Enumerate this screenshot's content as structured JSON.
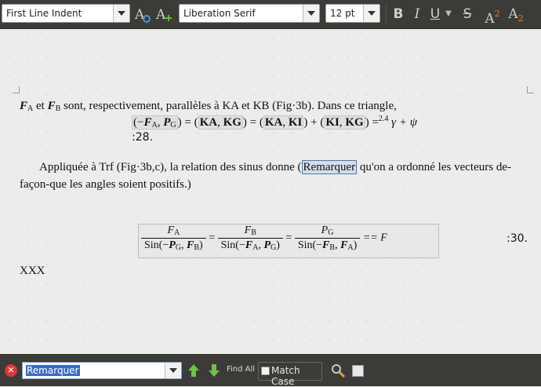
{
  "toolbar": {
    "paragraph_style": "First Line Indent",
    "font_name": "Liberation Serif",
    "font_size": "12 pt",
    "bold": "B",
    "italic": "I",
    "underline": "U",
    "strike": "S",
    "superscript": "A",
    "superscript_mark": "2",
    "subscript": "A",
    "subscript_mark": "2"
  },
  "document": {
    "line1": {
      "fa": "F",
      "fa_sub": "A",
      "et": " et ",
      "fb": "F",
      "fb_sub": "B",
      "rest": " sont, respectivement, parallèles à KA et KB (Fig·3b). Dans ce triangle,"
    },
    "eq1": {
      "open": "(−",
      "fa": "F",
      "fa_sub": "A",
      "comma1": ", ",
      "pg": "P",
      "pg_sub": "G",
      "close1": ") = (",
      "ka1": "KA",
      "comma2": ", ",
      "kg1": "KG",
      "close2": ") = (",
      "ka2": "KA",
      "comma3": ", ",
      "ki1": "KI",
      "close3": ") + (",
      "ki2": "KI",
      "comma4": ", ",
      "kg2": "KG",
      "close4": ") =",
      "ref": "2.4",
      "tail": " γ + ψ"
    },
    "eq1_number": ":28.",
    "para2": {
      "before": "Appliquée à Trf (Fig·3b,c), la relation des sinus donne (",
      "highlight": "Remarquer",
      "after": " qu'on a ordonné les vecteurs de-",
      "line2": "façon-que les angles soient positifs.)"
    },
    "eq2": {
      "f1_num": "F",
      "f1_num_sub": "A",
      "f1_den_pre": "Sin(−",
      "f1_den_p": "P",
      "f1_den_p_sub": "G",
      "f1_den_comma": ", ",
      "f1_den_f": "F",
      "f1_den_f_sub": "B",
      "f1_den_close": ")",
      "eq": "=",
      "f2_num": "F",
      "f2_num_sub": "B",
      "f2_den_pre": "Sin(−",
      "f2_den_f": "F",
      "f2_den_f_sub": "A",
      "f2_den_comma": ", ",
      "f2_den_p": "P",
      "f2_den_p_sub": "G",
      "f2_den_close": ")",
      "f3_num": "P",
      "f3_num_sub": "G",
      "f3_den_pre": "Sin(−",
      "f3_den_f1": "F",
      "f3_den_f1_sub": "B",
      "f3_den_comma": ", ",
      "f3_den_f2": "F",
      "f3_den_f2_sub": "A",
      "f3_den_close": ")",
      "final": "== F"
    },
    "eq2_number": ":30.",
    "xxx": "XXX"
  },
  "findbar": {
    "search_value": "Remarquer",
    "find_all": "Find All",
    "match_case": "Match Case"
  }
}
